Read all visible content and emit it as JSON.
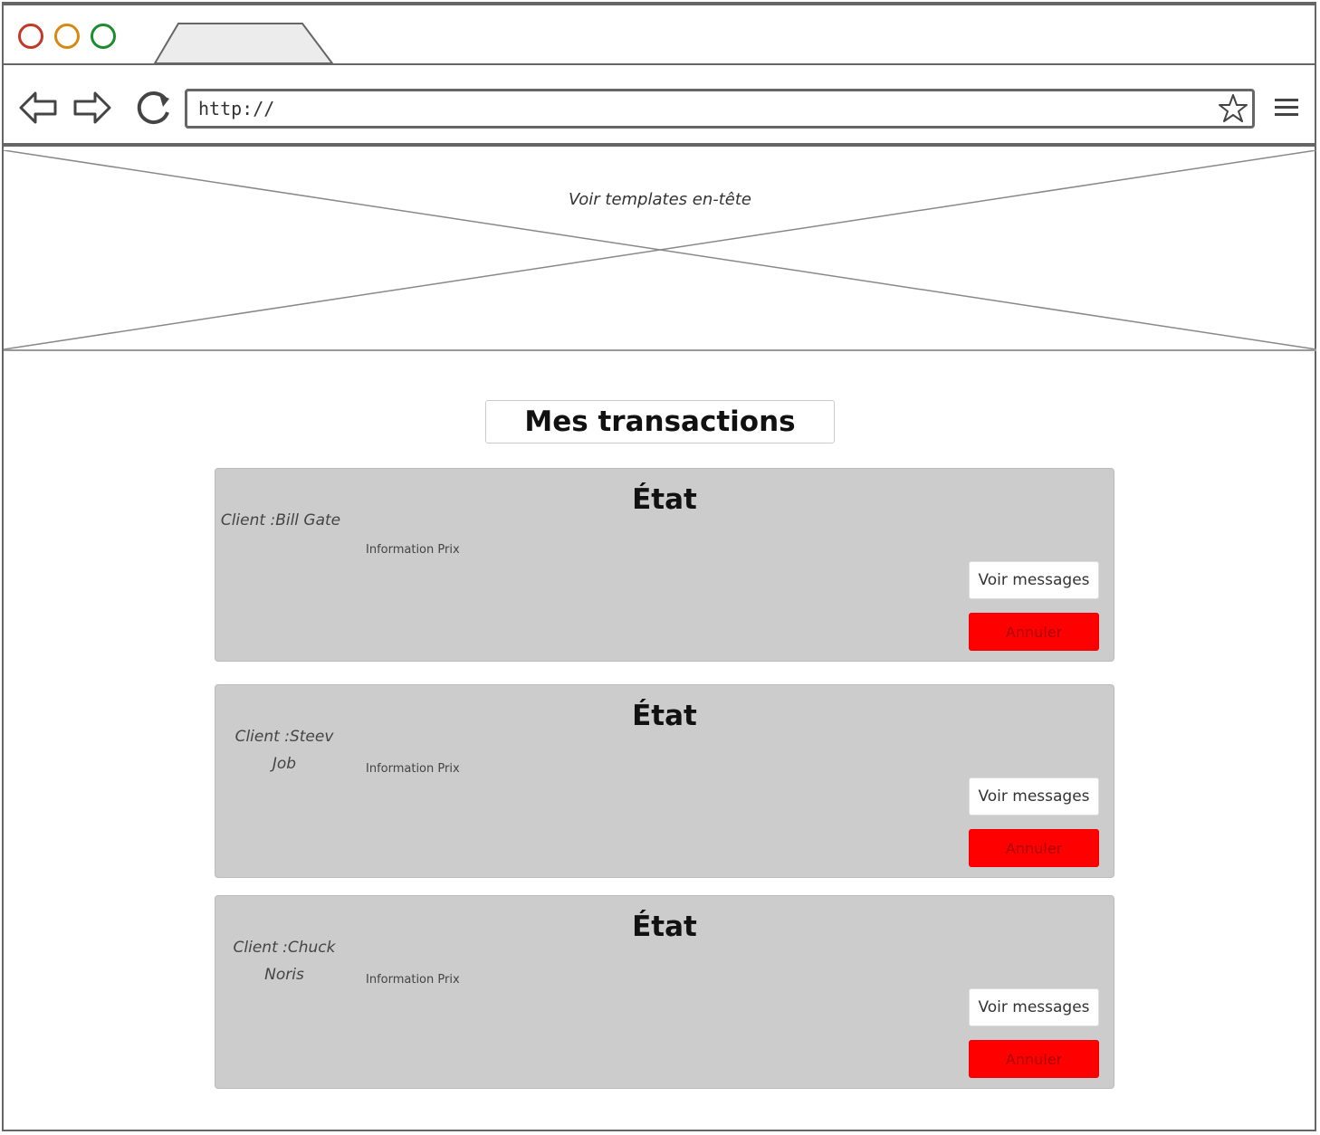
{
  "browser": {
    "url": "http://"
  },
  "header": {
    "placeholder_label": "Voir templates en-tête"
  },
  "main": {
    "title": "Mes transactions",
    "transactions": [
      {
        "state": "État",
        "client_lines": [
          "Client :Bill Gate"
        ],
        "price_info": "Information Prix",
        "messages_label": "Voir messages",
        "cancel_label": "Annuler"
      },
      {
        "state": "État",
        "client_lines": [
          "Client :Steev",
          "Job"
        ],
        "price_info": "Information Prix",
        "messages_label": "Voir messages",
        "cancel_label": "Annuler"
      },
      {
        "state": "État",
        "client_lines": [
          "Client :Chuck",
          "Noris"
        ],
        "price_info": "Information Prix",
        "messages_label": "Voir messages",
        "cancel_label": "Annuler"
      }
    ]
  },
  "colors": {
    "card_bg": "#cccccc",
    "cancel_bg": "#ff0000",
    "frame": "#666666"
  }
}
